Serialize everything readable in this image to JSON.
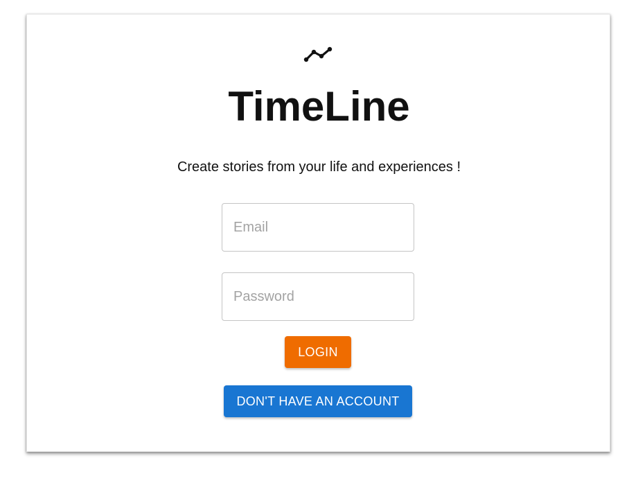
{
  "app": {
    "logo_icon": "timeline-chart-icon",
    "title": "TimeLine",
    "tagline": "Create stories from your life and experiences !"
  },
  "login_form": {
    "email": {
      "placeholder": "Email",
      "value": ""
    },
    "password": {
      "placeholder": "Password",
      "value": ""
    },
    "login_button_label": "LOGIN",
    "signup_button_label": "DON'T HAVE AN ACCOUNT"
  },
  "colors": {
    "login_button": "#ef6c00",
    "signup_button": "#1976d2",
    "text": "#111111",
    "placeholder": "#a3a3a3",
    "field_border": "#c4c4c4"
  }
}
